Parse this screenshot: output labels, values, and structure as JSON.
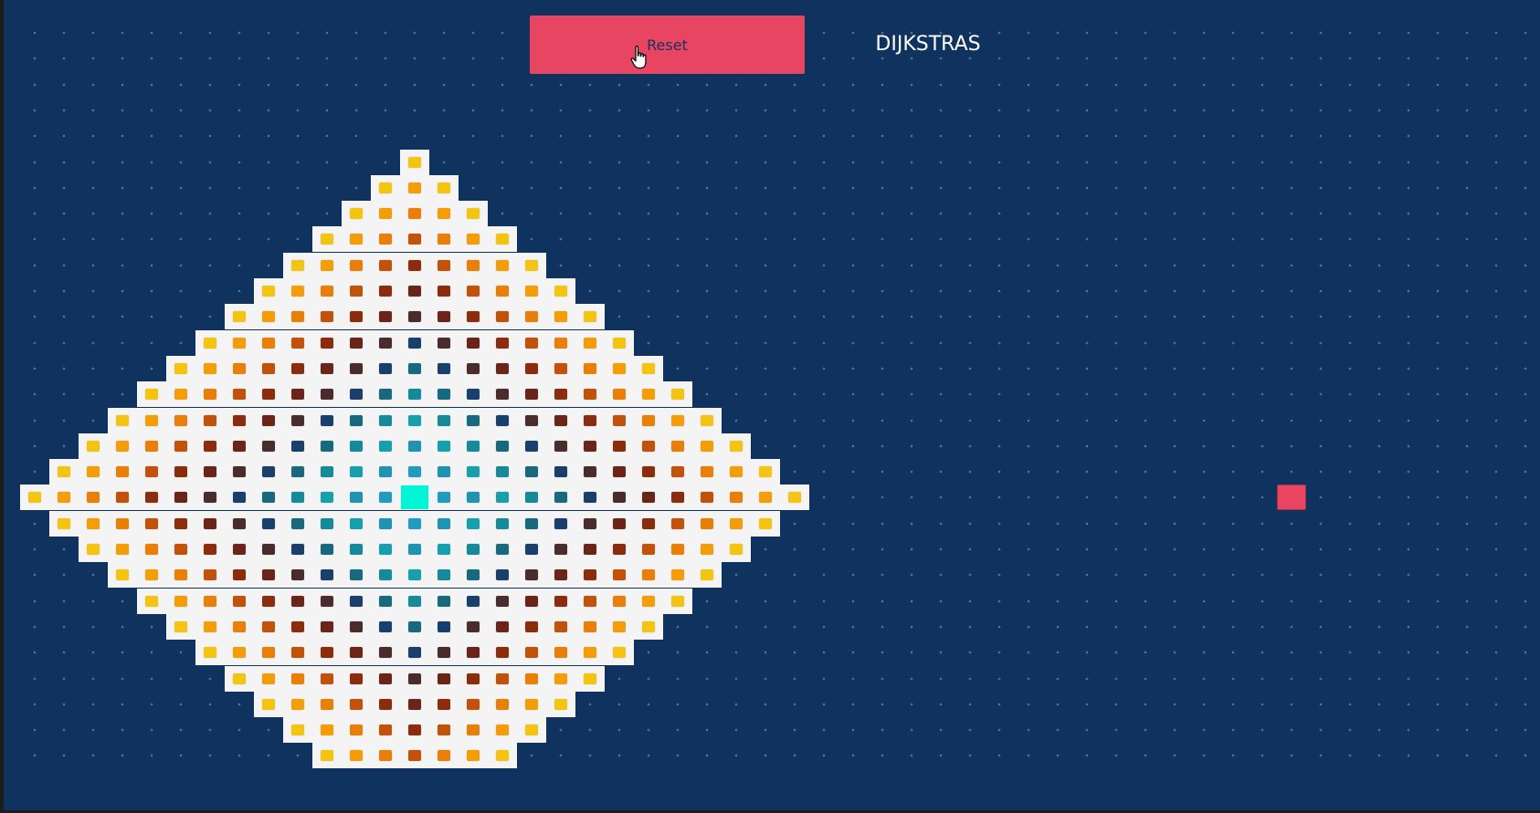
{
  "toolbar": {
    "reset_label": "Reset",
    "algorithm_title": "DIJKSTRAS"
  },
  "grid": {
    "columns": 52,
    "rows": 29,
    "start": {
      "col": 13,
      "row": 18
    },
    "target": {
      "col": 43,
      "row": 18
    },
    "visited_radius": 13,
    "visited_color_ramp": [
      "#00f5d4",
      "#1f9cc0",
      "#1e93b2",
      "#16a0ad",
      "#158a9b",
      "#176a7e",
      "#193f6d",
      "#4b2c2c",
      "#6b2418",
      "#8b2d0d",
      "#c2520a",
      "#e97f06",
      "#f59d07",
      "#f4c411"
    ],
    "colors": {
      "background": "#10325e",
      "visited_cell_bg": "#f4f4f4",
      "start": "#00f5d4",
      "target": "#e84562",
      "reset_button": "#e84562"
    }
  },
  "icons": {
    "cursor": "hand-pointer-icon"
  }
}
